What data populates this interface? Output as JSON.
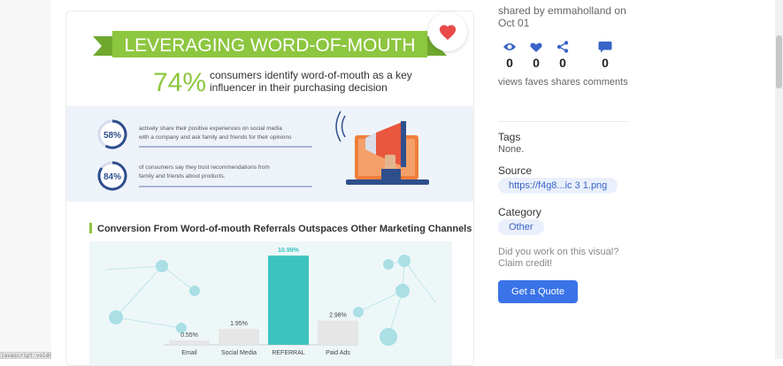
{
  "infographic": {
    "banner_title": "LEVERAGING WORD-OF-MOUTH",
    "headline_percent": "74%",
    "headline_line1": "consumers identify word-of-mouth as a key",
    "headline_line2": "influencer in their purchasing decision",
    "stat1_percent": "58%",
    "stat1_line1": "actively share their positive experiences on social media",
    "stat1_line2": "with a company and ask family and friends for their opinions",
    "stat2_percent": "84%",
    "stat2_line1": "of consumers say they trust recommendations from",
    "stat2_line2": "family and friends about products.",
    "chart_heading": "Conversion From Word-of-mouth Referrals Outspaces Other Marketing Channels"
  },
  "chart_data": {
    "type": "bar",
    "title": "Conversion From Word-of-mouth Referrals Outspaces Other Marketing Channels",
    "categories": [
      "Email",
      "Social Media",
      "REFERRAL",
      "Paid Ads"
    ],
    "values": [
      0.55,
      1.95,
      10.99,
      2.98
    ],
    "value_labels": [
      "0.55%",
      "1.95%",
      "10.99%",
      "2.98%"
    ],
    "ylim": [
      0,
      11
    ],
    "grid": false,
    "colors": [
      "#e6e6e6",
      "#e6e6e6",
      "#3cc3c0",
      "#e6e6e6"
    ],
    "highlight_label_color": "#3cc3c0"
  },
  "sidebar": {
    "shared_by": "shared by emmaholland on Oct 01",
    "stats": [
      {
        "icon": "eye-icon",
        "value": "0"
      },
      {
        "icon": "heart-icon",
        "value": "0"
      },
      {
        "icon": "share-icon",
        "value": "0"
      },
      {
        "icon": "comment-icon",
        "value": "0"
      }
    ],
    "stat_labels": "views faves shares comments",
    "tags_label": "Tags",
    "tags_value": "None.",
    "source_label": "Source",
    "source_link": "https://f4g8...ic 3 1.png",
    "category_label": "Category",
    "category_value": "Other",
    "claim_text": "Did you work on this visual? Claim credit!",
    "quote_button": "Get a Quote"
  },
  "statusbar": {
    "text": "javascript:void(0)"
  },
  "colors": {
    "accent": "#3a73e8",
    "banner_green": "#8dc63f",
    "teal": "#3cc3c0",
    "navy": "#2f4f8c",
    "heart": "#e84a4a",
    "orange": "#f07e3a"
  }
}
